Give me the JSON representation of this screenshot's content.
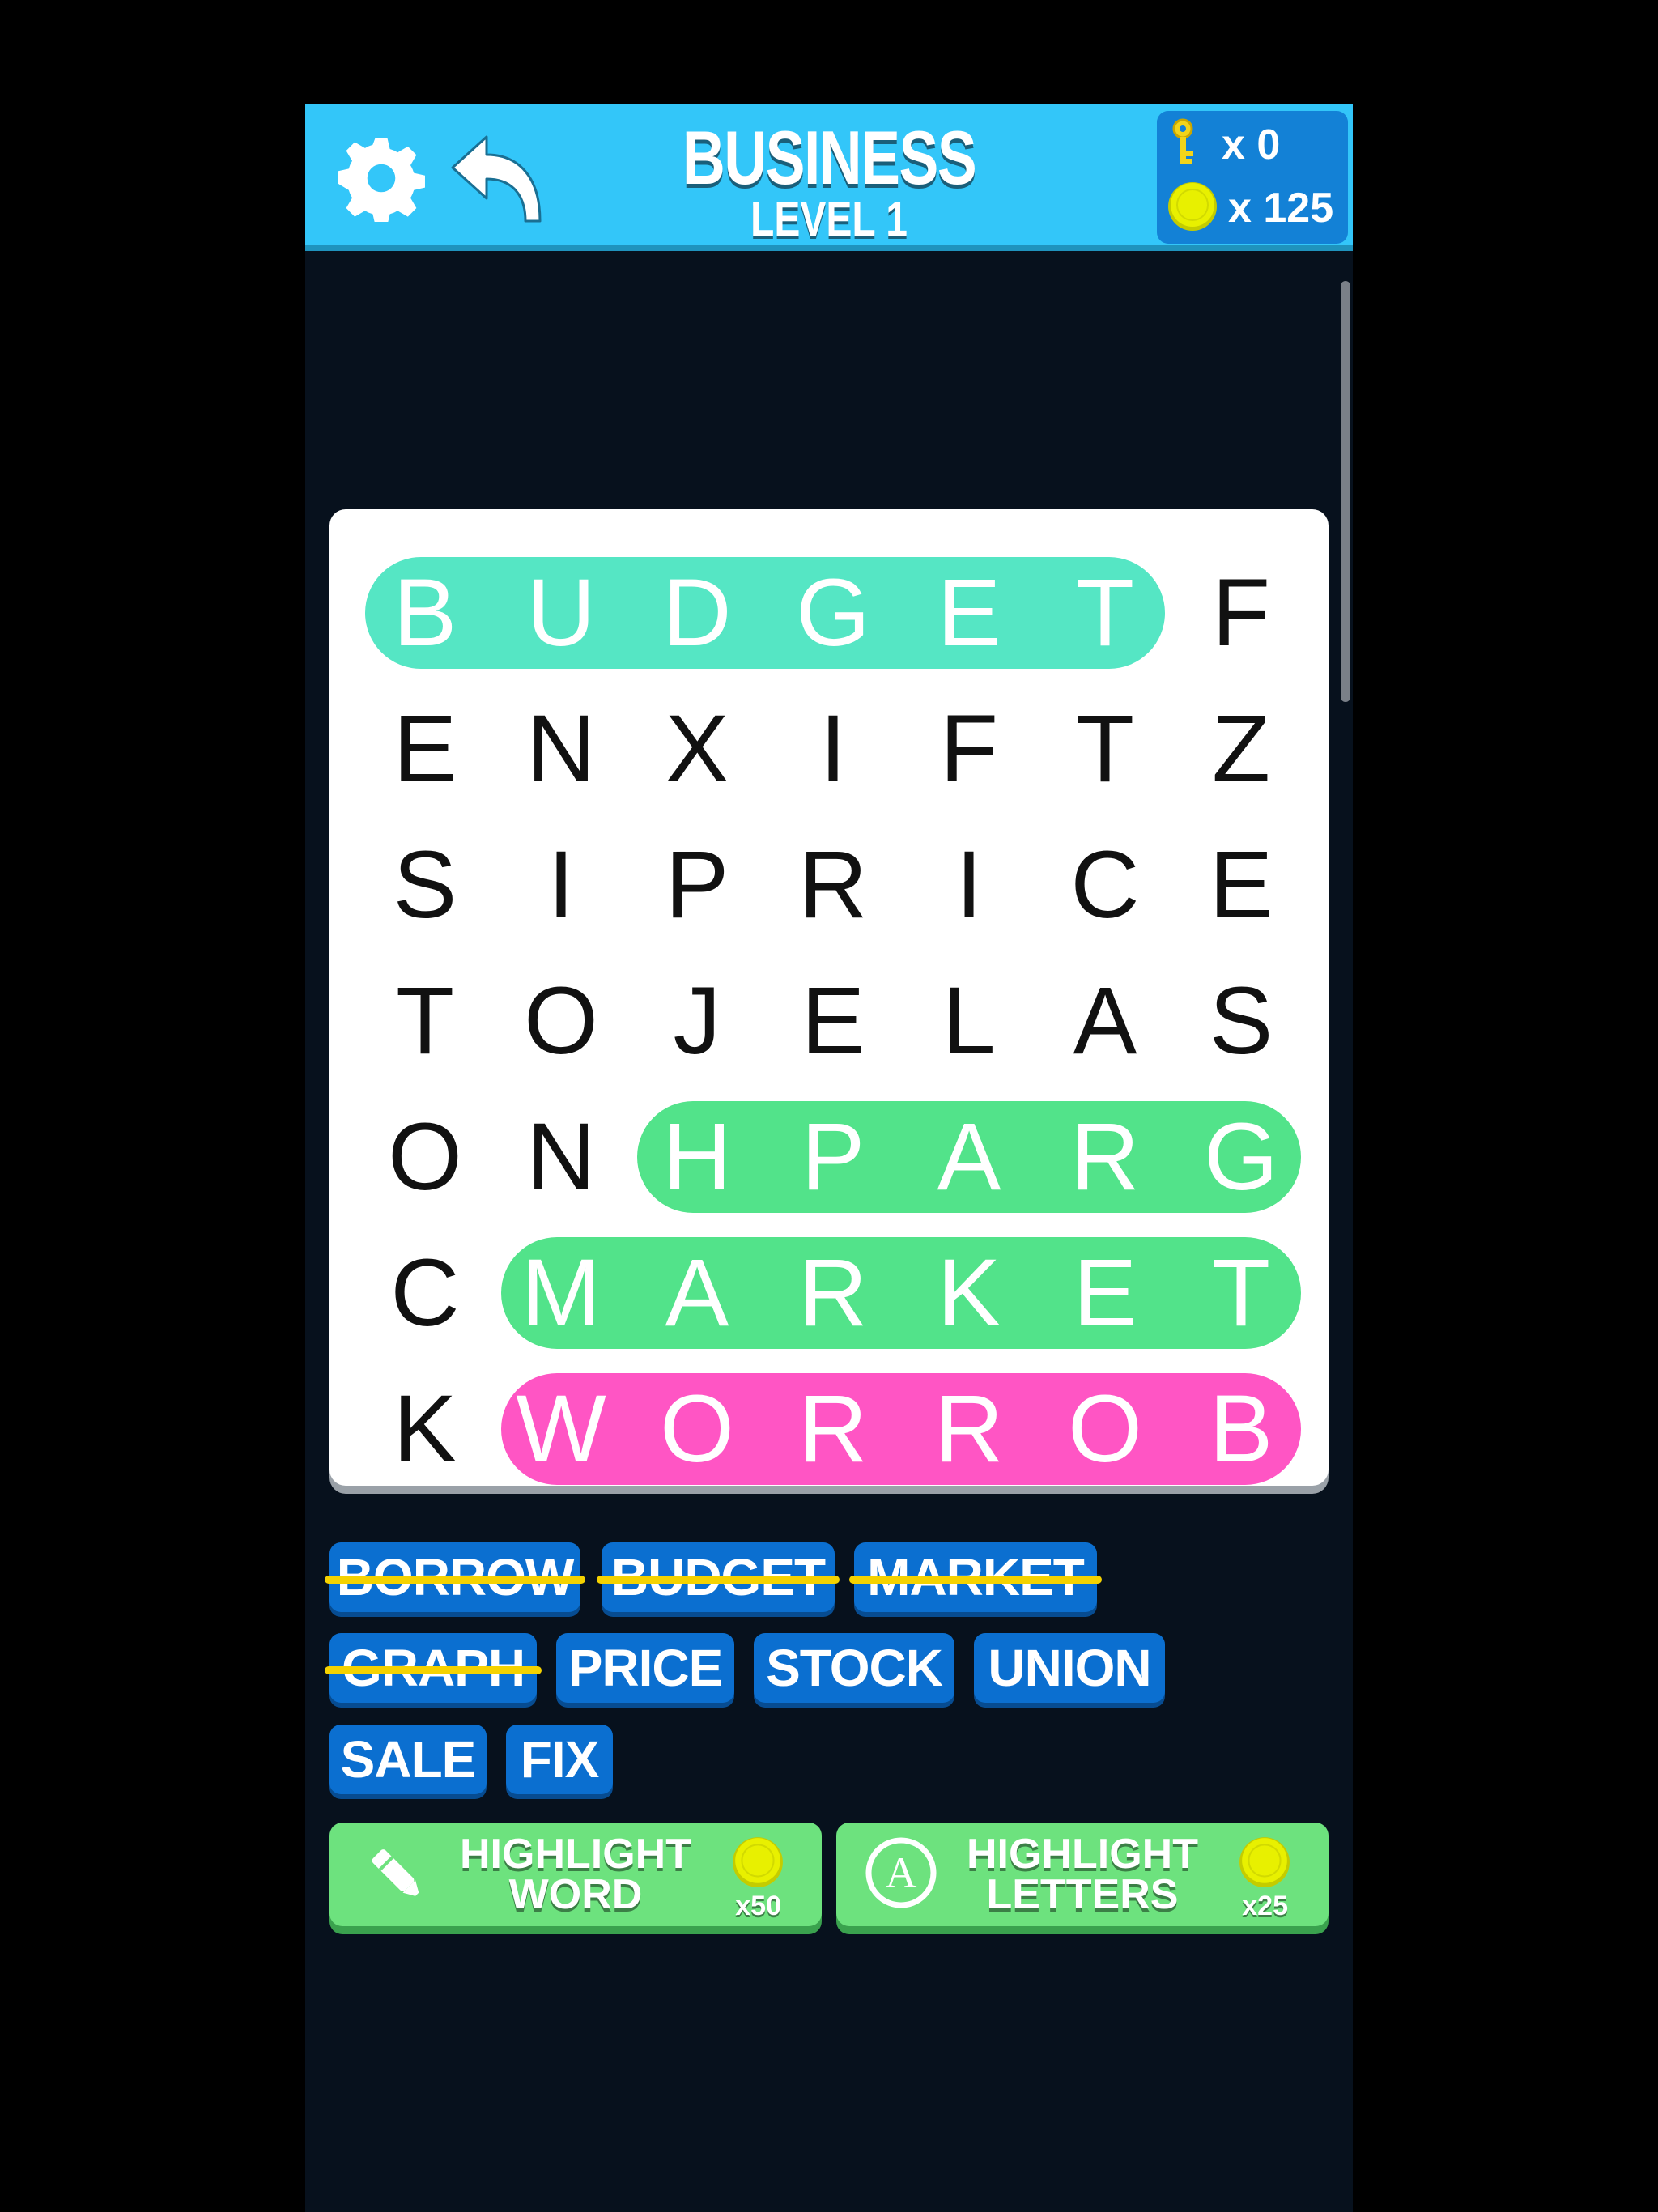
{
  "header": {
    "category": "BUSINESS",
    "level": "LEVEL 1",
    "keys_label": "x 0",
    "coins_label": "x 125"
  },
  "grid": {
    "rows": [
      [
        "B",
        "U",
        "D",
        "G",
        "E",
        "T",
        "F"
      ],
      [
        "E",
        "N",
        "X",
        "I",
        "F",
        "T",
        "Z"
      ],
      [
        "S",
        "I",
        "P",
        "R",
        "I",
        "C",
        "E"
      ],
      [
        "T",
        "O",
        "J",
        "E",
        "L",
        "A",
        "S"
      ],
      [
        "O",
        "N",
        "H",
        "P",
        "A",
        "R",
        "G"
      ],
      [
        "C",
        "M",
        "A",
        "R",
        "K",
        "E",
        "T"
      ],
      [
        "K",
        "W",
        "O",
        "R",
        "R",
        "O",
        "B"
      ]
    ],
    "found_highlights": [
      {
        "word": "BUDGET",
        "row": 0,
        "col_start": 0,
        "col_end": 5,
        "color": "#55e6c4"
      },
      {
        "word": "GRAPH",
        "row": 4,
        "col_start": 2,
        "col_end": 6,
        "color": "#52e38a"
      },
      {
        "word": "MARKET",
        "row": 5,
        "col_start": 1,
        "col_end": 6,
        "color": "#52e38a"
      },
      {
        "word": "BORROW",
        "row": 6,
        "col_start": 1,
        "col_end": 6,
        "color": "#ff55c4"
      }
    ]
  },
  "word_list": [
    {
      "word": "BORROW",
      "found": true
    },
    {
      "word": "BUDGET",
      "found": true
    },
    {
      "word": "MARKET",
      "found": true
    },
    {
      "word": "GRAPH",
      "found": true
    },
    {
      "word": "PRICE",
      "found": false
    },
    {
      "word": "STOCK",
      "found": false
    },
    {
      "word": "UNION",
      "found": false
    },
    {
      "word": "SALE",
      "found": false
    },
    {
      "word": "FIX",
      "found": false
    }
  ],
  "powerups": {
    "highlight_word": {
      "line1": "HIGHLIGHT",
      "line2": "WORD",
      "cost": "x50",
      "icon": "marker-icon"
    },
    "highlight_letters": {
      "line1": "HIGHLIGHT",
      "line2": "LETTERS",
      "cost": "x25",
      "icon": "letter-a-icon"
    }
  },
  "colors": {
    "header_bg": "#33c6f9",
    "wallet_bg": "#1381d6",
    "background": "#07111d",
    "chip_bg": "#0b6fd0",
    "strike": "#f5d200",
    "powerup_bg": "#6de27e",
    "coin": "#e8f000"
  }
}
